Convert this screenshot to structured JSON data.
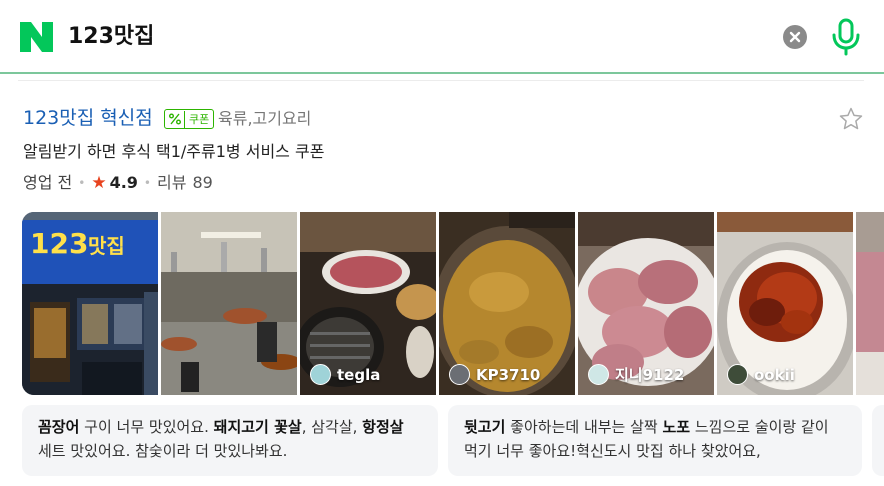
{
  "search": {
    "query": "123맛집"
  },
  "place": {
    "name": "123맛집 혁신점",
    "coupon_badge": "쿠폰",
    "category": "육류,고기요리",
    "promo": "알림받기 하면 후식 택1/주류1병 서비스 쿠폰",
    "status": "영업 전",
    "rating": "4.9",
    "review_label": "리뷰",
    "review_count": "89"
  },
  "sign": {
    "line1": "123",
    "line2": "맛집"
  },
  "photos": [
    {
      "credit": ""
    },
    {
      "credit": ""
    },
    {
      "credit": "tegla"
    },
    {
      "credit": "KP3710"
    },
    {
      "credit": "지니9122"
    },
    {
      "credit": "ookii"
    }
  ],
  "reviews": [
    {
      "s1": "꼼장어",
      "t1": " 구이 너무 맛있어요. ",
      "s2": "돼지고기 꽃살",
      "t2": ", 삼각살, ",
      "s3": "항정살",
      "t3": " 세트 맛있어요. 참숯이라 더 맛있나봐요."
    },
    {
      "s1": "뒷고기",
      "t1": " 좋아하는데 내부는 살짝 ",
      "s2": "노포",
      "t2": " 느낌으로 술이랑 같이 먹기 너무 좋아요!혁신도시 맛집 하나 찾았어요,"
    }
  ],
  "colors": {
    "naver_green": "#03c75a",
    "link_blue": "#1a5fb4",
    "star_red": "#e8431f"
  },
  "icons": [
    "naver-logo-icon",
    "clear-icon",
    "mic-icon",
    "coupon-icon",
    "bookmark-star-icon",
    "rating-star-icon"
  ]
}
